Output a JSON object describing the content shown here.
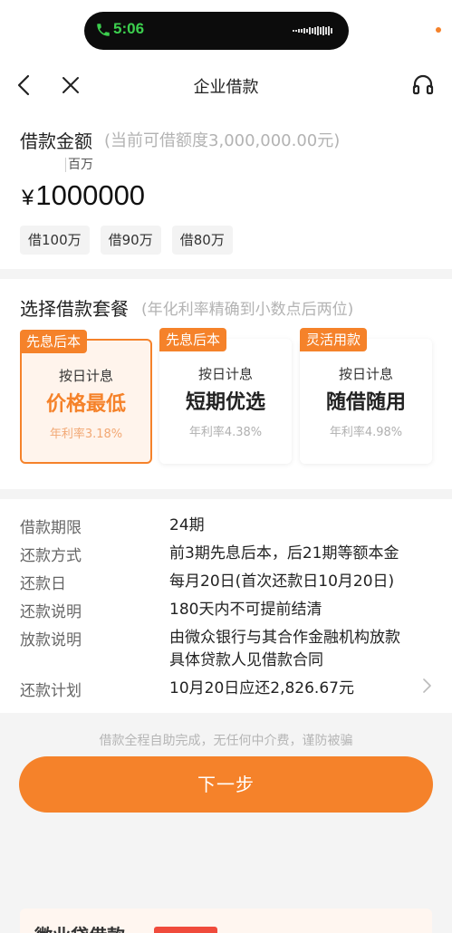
{
  "status": {
    "time": "5:06"
  },
  "nav": {
    "title": "企业借款"
  },
  "amount": {
    "label": "借款金额",
    "hint": "(当前可借额度3,000,000.00元)",
    "unit": "百万",
    "currency": "¥",
    "value": "1000000",
    "quick_options": [
      "借100万",
      "借90万",
      "借80万"
    ]
  },
  "plan": {
    "label": "选择借款套餐",
    "hint": "(年化利率精确到小数点后两位)",
    "cards": [
      {
        "tag": "先息后本",
        "sub": "按日计息",
        "main": "价格最低",
        "rate": "年利率3.18%",
        "selected": true
      },
      {
        "tag": "先息后本",
        "sub": "按日计息",
        "main": "短期优选",
        "rate": "年利率4.38%",
        "selected": false
      },
      {
        "tag": "灵活用款",
        "sub": "按日计息",
        "main": "随借随用",
        "rate": "年利率4.98%",
        "selected": false
      }
    ]
  },
  "details": [
    {
      "key": "借款期限",
      "value": "24期"
    },
    {
      "key": "还款方式",
      "value": "前3期先息后本，后21期等额本金"
    },
    {
      "key": "还款日",
      "value": "每月20日(首次还款日10月20日)"
    },
    {
      "key": "还款说明",
      "value": "180天内不可提前结清"
    },
    {
      "key": "放款说明",
      "value": "由微众银行与其合作金融机构放款\n具体贷款人见借款合同"
    },
    {
      "key": "还款计划",
      "value": "10月20日应还2,826.67元"
    }
  ],
  "disclaimer": "借款全程自助完成，无任何中介费，谨防被骗",
  "next_button": "下一步",
  "promo": {
    "title": "微业贷借款"
  },
  "colors": {
    "accent": "#f5822a",
    "selected_bg": "#fff4ec",
    "status_time": "#3ccf4e"
  }
}
